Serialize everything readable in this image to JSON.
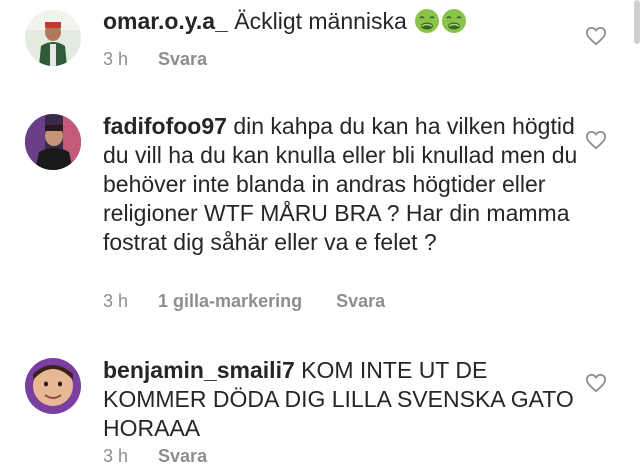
{
  "comments": [
    {
      "username": "omar.o.y.a_",
      "text": " Äckligt människa",
      "emoji_icons": [
        "nauseated-face-icon",
        "nauseated-face-icon"
      ],
      "time": "3 h",
      "likes": "",
      "reply": "Svara"
    },
    {
      "username": "fadifofoo97",
      "text": " din kahpa du kan ha vilken högtid du vill ha du kan knulla eller bli knullad men du behöver inte blanda in andras högtider eller religioner WTF MÅRU BRA ? Har din mamma fostrat dig såhär eller va e felet ?",
      "time": "3 h",
      "likes": "1 gilla-markering",
      "reply": "Svara"
    },
    {
      "username": "benjamin_smaili7",
      "text": " KOM INTE UT DE KOMMER DÖDA DIG LILLA SVENSKA GATO HORAAA",
      "time": "3 h",
      "likes": "",
      "reply": "Svara"
    }
  ],
  "colors": {
    "text": "#262626",
    "meta": "#8e8e8e",
    "heart_outline": "#8e8e8e",
    "emoji": "#8bc34a"
  }
}
